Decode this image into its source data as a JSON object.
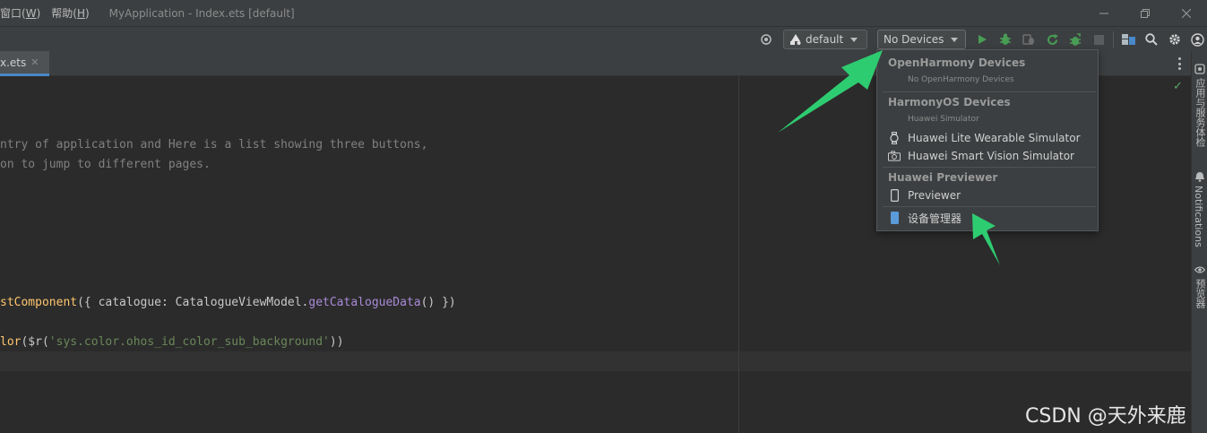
{
  "menu": {
    "window_label": "窗口(",
    "window_key": "W",
    "help_label": "帮助(",
    "help_key": "H",
    "close_paren": ")"
  },
  "window": {
    "title": "MyApplication - Index.ets [default]",
    "minimize_icon": "minimize-icon",
    "maximize_icon": "restore-icon",
    "close_icon": "close-icon"
  },
  "toolbar": {
    "target_combo": "default",
    "device_combo": "No Devices",
    "icons": [
      "locate-icon",
      "module-icon",
      "run-icon",
      "debug-icon",
      "attach-debugger-icon",
      "apply-changes-icon",
      "profile-icon",
      "stop-icon",
      "project-structure-icon",
      "search-icon",
      "settings-icon",
      "account-icon"
    ],
    "colors": {
      "run": "#499c54",
      "accent": "#4a88c7"
    }
  },
  "tab": {
    "label": "x.ets",
    "close_glyph": "✕"
  },
  "editor": {
    "lines": [
      {
        "segments": [
          {
            "cls": "cmt",
            "text": "ntry of application and Here is a list showing three buttons,"
          }
        ]
      },
      {
        "segments": [
          {
            "cls": "cmt",
            "text": "on to jump to different pages."
          }
        ]
      },
      {
        "segments": [
          {
            "cls": "fn",
            "text": "stComponent"
          },
          {
            "cls": "plain",
            "text": "({ catalogue: CatalogueViewModel."
          },
          {
            "cls": "callfn",
            "text": "getCatalogueData"
          },
          {
            "cls": "plain",
            "text": "() })"
          }
        ]
      },
      {
        "segments": [
          {
            "cls": "fn",
            "text": "lor"
          },
          {
            "cls": "plain",
            "text": "($r("
          },
          {
            "cls": "str",
            "text": "'sys.color.ohos_id_color_sub_background'"
          },
          {
            "cls": "plain",
            "text": "))"
          }
        ]
      }
    ]
  },
  "right_strip": {
    "items": [
      "应用与服务体检",
      "Notifications",
      "预览器"
    ]
  },
  "dropdown": {
    "sections": [
      {
        "title": "OpenHarmony Devices",
        "subtitle": "No OpenHarmony Devices"
      },
      {
        "title": "HarmonyOS Devices",
        "subtitle": "Huawei Simulator"
      },
      {
        "title": "Huawei Previewer"
      }
    ],
    "items": {
      "wearable": "Huawei Lite Wearable Simulator",
      "vision": "Huawei Smart Vision Simulator",
      "previewer": "Previewer",
      "device_manager": "设备管理器"
    }
  },
  "watermark": "CSDN @天外来鹿",
  "annotation_color": "#2ecc71"
}
